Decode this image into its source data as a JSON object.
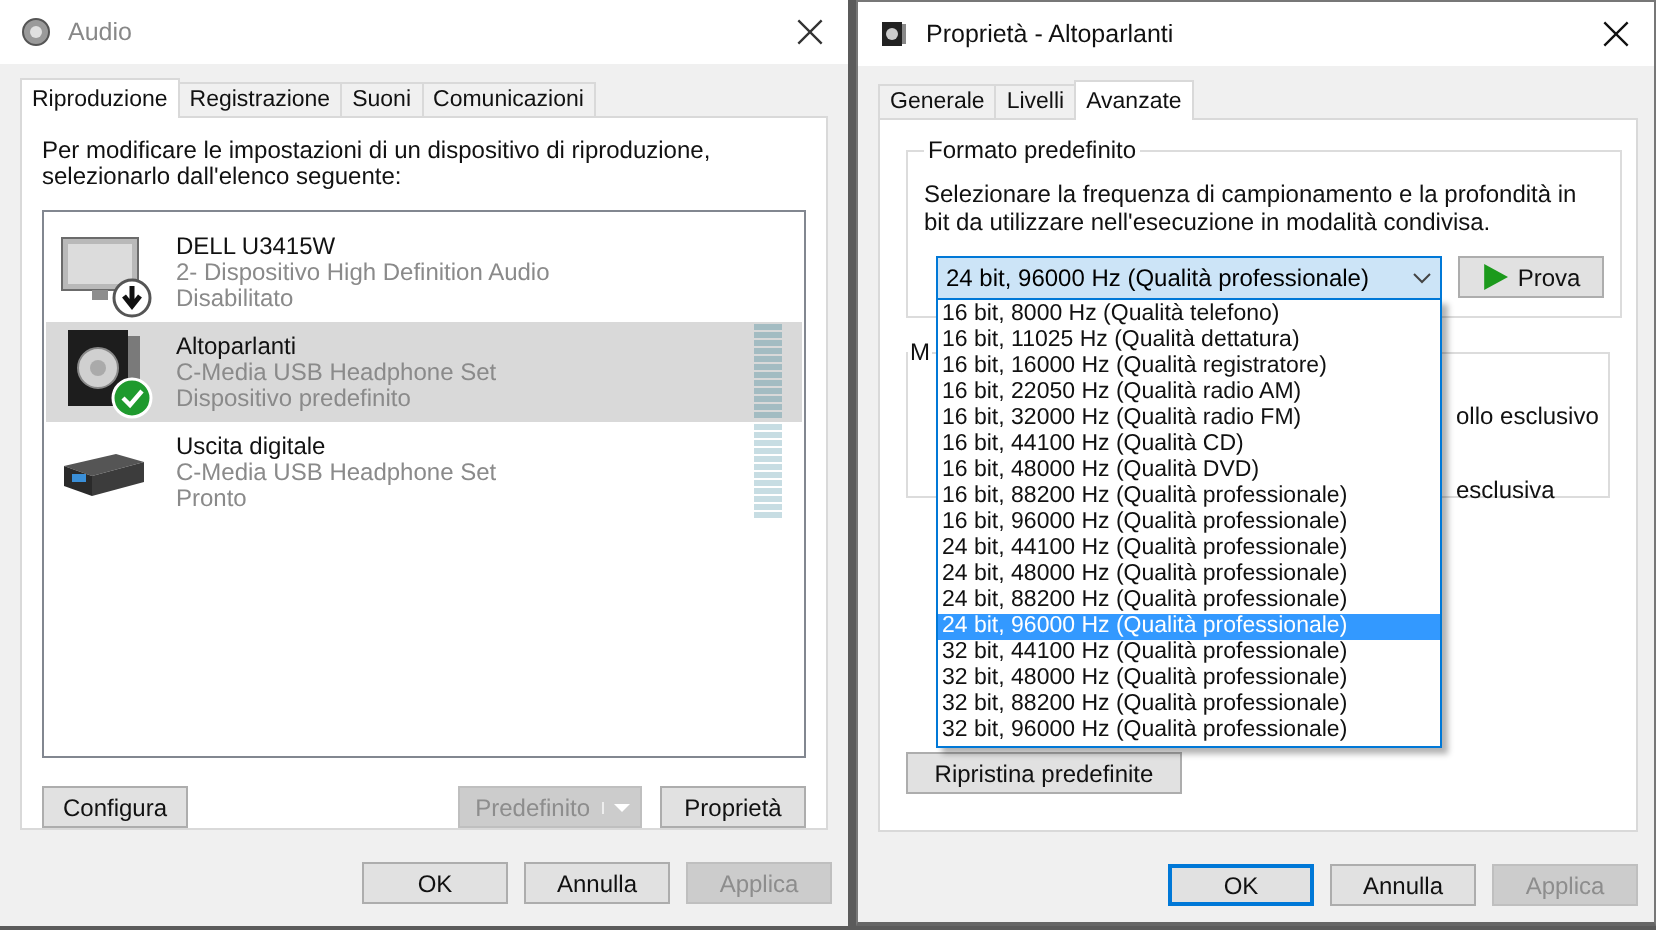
{
  "audio_window": {
    "title": "Audio",
    "tabs": [
      {
        "label": "Riproduzione",
        "selected": true
      },
      {
        "label": "Registrazione",
        "selected": false
      },
      {
        "label": "Suoni",
        "selected": false
      },
      {
        "label": "Comunicazioni",
        "selected": false
      }
    ],
    "instructions": "Per modificare le impostazioni di un dispositivo di riproduzione, selezionarlo dall'elenco seguente:",
    "devices": [
      {
        "kind": "monitor",
        "name": "DELL U3415W",
        "detail": "2- Dispositivo High Definition Audio",
        "status": "Disabilitato",
        "disabled": true,
        "default": false,
        "selected": false,
        "meter": false
      },
      {
        "kind": "speaker",
        "name": "Altoparlanti",
        "detail": "C-Media USB Headphone Set",
        "status": "Dispositivo predefinito",
        "disabled": false,
        "default": true,
        "selected": true,
        "meter": true
      },
      {
        "kind": "receiver",
        "name": "Uscita digitale",
        "detail": "C-Media USB Headphone Set",
        "status": "Pronto",
        "disabled": false,
        "default": false,
        "selected": false,
        "meter": true
      }
    ],
    "list_buttons": [
      {
        "label": "Configura",
        "kind": "plain",
        "disabled": false
      },
      {
        "label": "Predefinito",
        "kind": "split",
        "disabled": true
      },
      {
        "label": "Proprietà",
        "kind": "plain",
        "disabled": false
      }
    ],
    "buttons": [
      {
        "label": "OK",
        "disabled": false,
        "focused": false
      },
      {
        "label": "Annulla",
        "disabled": false,
        "focused": false
      },
      {
        "label": "Applica",
        "disabled": true,
        "focused": false
      }
    ]
  },
  "properties_window": {
    "title": "Proprietà - Altoparlanti",
    "tabs": [
      {
        "label": "Generale",
        "selected": false
      },
      {
        "label": "Livelli",
        "selected": false
      },
      {
        "label": "Avanzate",
        "selected": true
      }
    ],
    "format_group": {
      "title": "Formato predefinito",
      "description": "Selezionare la frequenza di campionamento e la profondità in bit da utilizzare nell'esecuzione in modalità condivisa.",
      "format": {
        "value": "24 bit, 96000 Hz (Qualità professionale)",
        "expanded": true,
        "options": [
          {
            "label": "16 bit, 8000 Hz (Qualità telefono)",
            "selected": false
          },
          {
            "label": "16 bit, 11025 Hz (Qualità dettatura)",
            "selected": false
          },
          {
            "label": "16 bit, 16000 Hz (Qualità registratore)",
            "selected": false
          },
          {
            "label": "16 bit, 22050 Hz (Qualità radio AM)",
            "selected": false
          },
          {
            "label": "16 bit, 32000 Hz (Qualità radio FM)",
            "selected": false
          },
          {
            "label": "16 bit, 44100 Hz (Qualità CD)",
            "selected": false
          },
          {
            "label": "16 bit, 48000 Hz (Qualità DVD)",
            "selected": false
          },
          {
            "label": "16 bit, 88200 Hz (Qualità professionale)",
            "selected": false
          },
          {
            "label": "16 bit, 96000 Hz (Qualità professionale)",
            "selected": false
          },
          {
            "label": "24 bit, 44100 Hz (Qualità professionale)",
            "selected": false
          },
          {
            "label": "24 bit, 48000 Hz (Qualità professionale)",
            "selected": false
          },
          {
            "label": "24 bit, 88200 Hz (Qualità professionale)",
            "selected": false
          },
          {
            "label": "24 bit, 96000 Hz (Qualità professionale)",
            "selected": true
          },
          {
            "label": "32 bit, 44100 Hz (Qualità professionale)",
            "selected": false
          },
          {
            "label": "32 bit, 48000 Hz (Qualità professionale)",
            "selected": false
          },
          {
            "label": "32 bit, 88200 Hz (Qualità professionale)",
            "selected": false
          },
          {
            "label": "32 bit, 96000 Hz (Qualità professionale)",
            "selected": false
          }
        ]
      },
      "test_button": "Prova"
    },
    "hidden_group": {
      "title": "M",
      "line_1": "ollo esclusivo",
      "line_2": "esclusiva"
    },
    "restore_button": "Ripristina predefinite",
    "buttons": [
      {
        "label": "OK",
        "disabled": false,
        "focused": true
      },
      {
        "label": "Annulla",
        "disabled": false,
        "focused": false
      },
      {
        "label": "Applica",
        "disabled": true,
        "focused": false
      }
    ]
  }
}
